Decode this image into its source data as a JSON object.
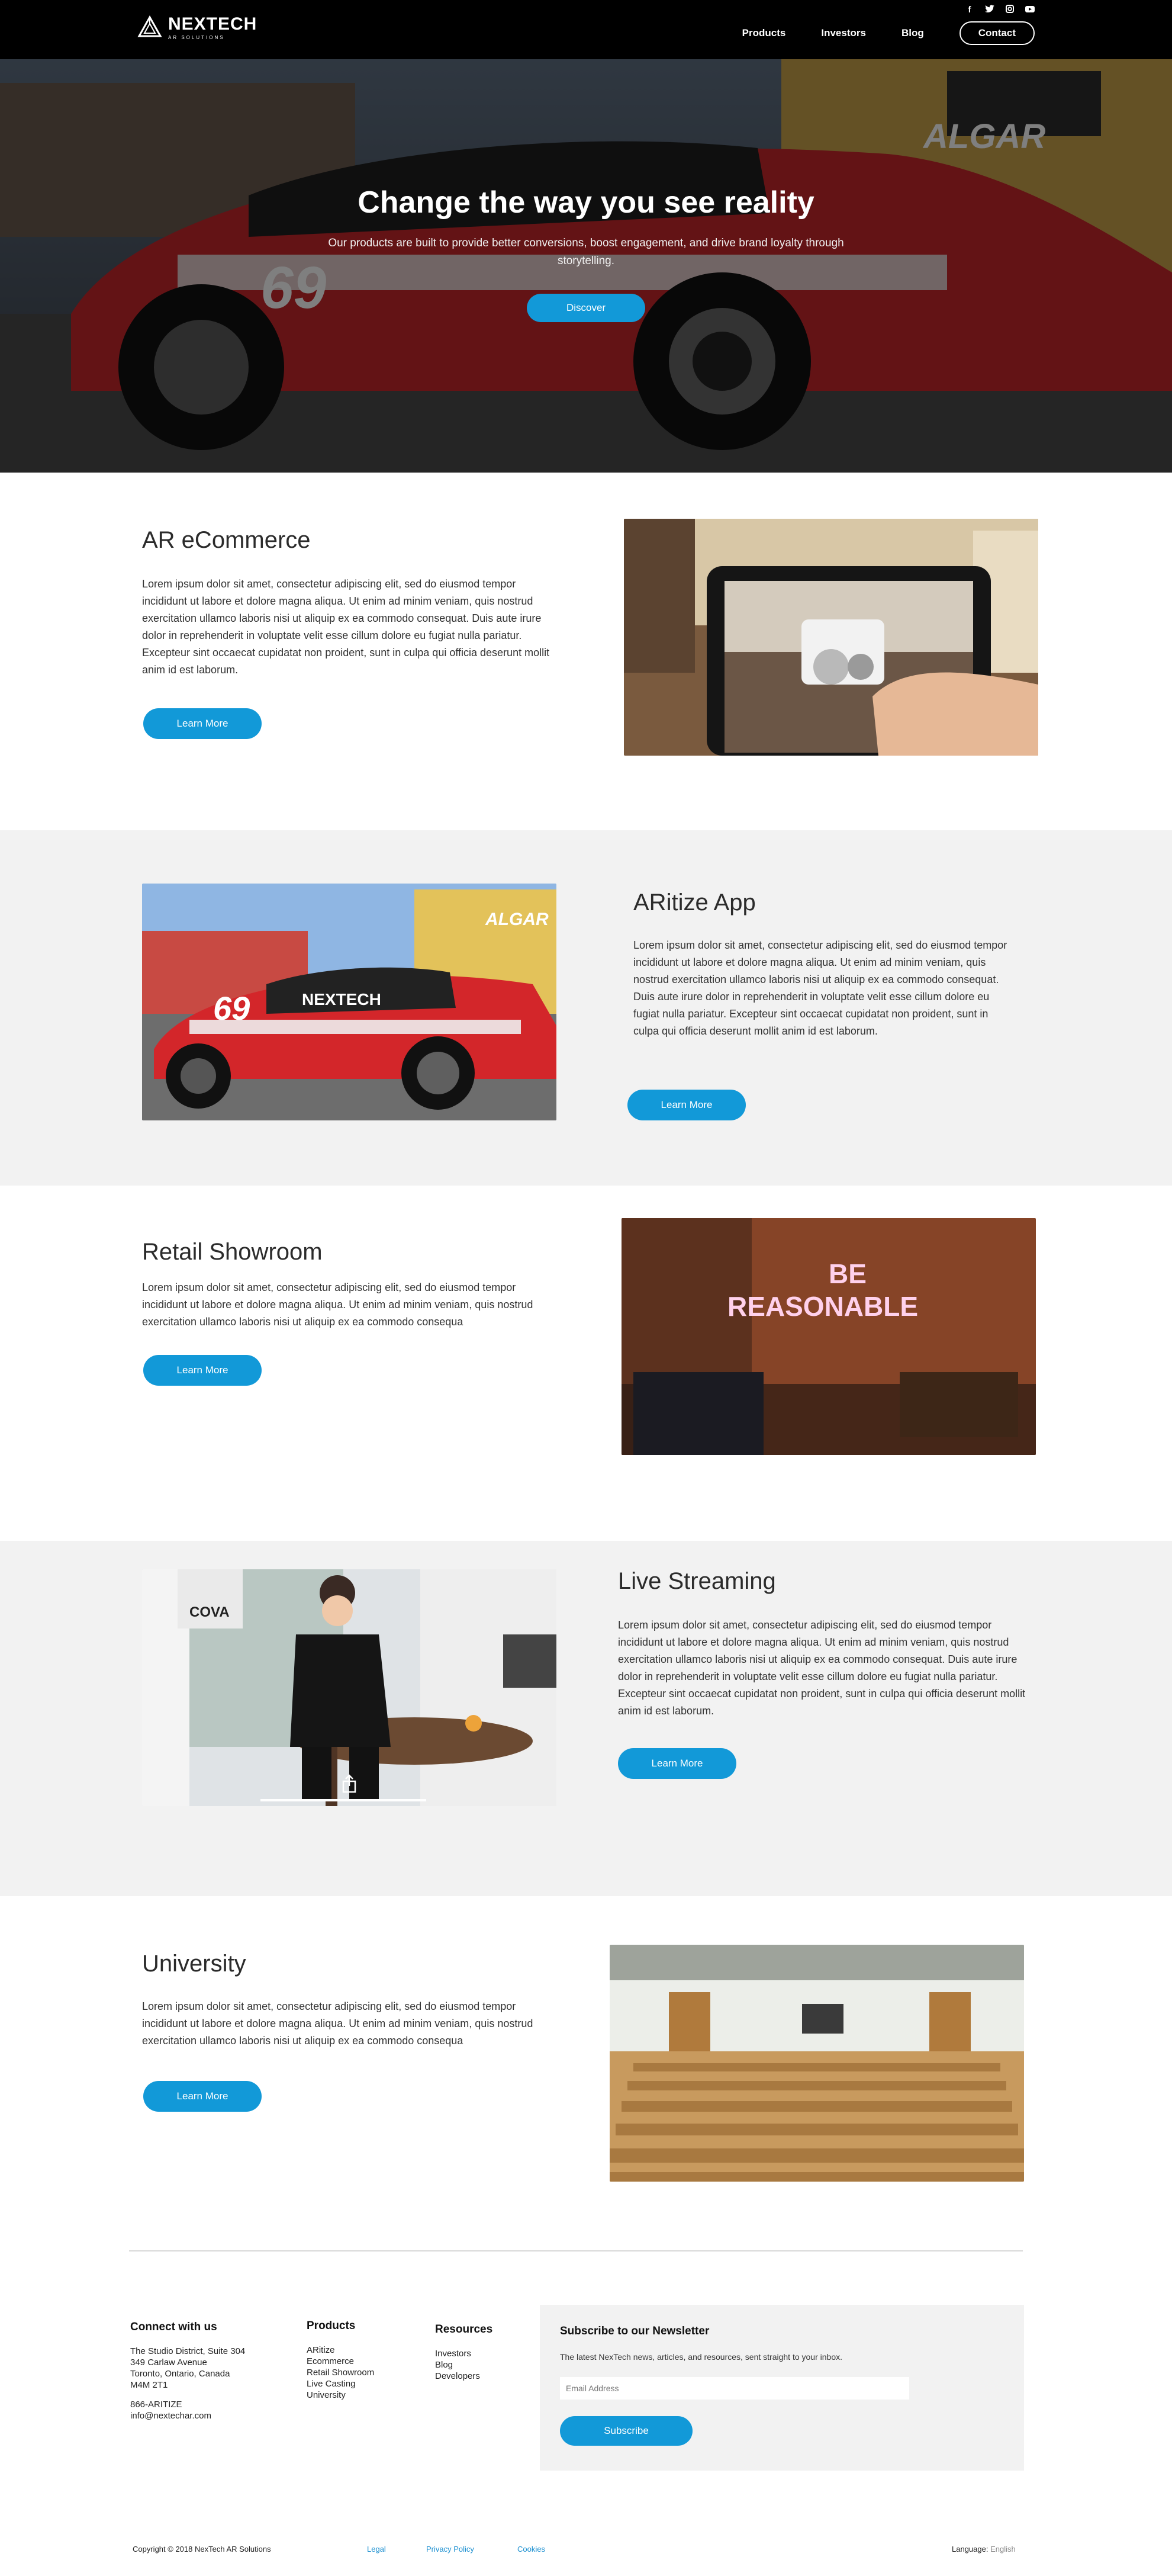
{
  "nav": {
    "brand_name": "NEXTECH",
    "brand_sub": "AR SOLUTIONS",
    "socials": [
      "f",
      "t",
      "ig",
      "yt"
    ],
    "links": [
      "Products",
      "Investors",
      "Blog"
    ],
    "contact": "Contact"
  },
  "hero": {
    "title": "Change the way you see reality",
    "subtitle": "Our products are built to provide better conversions, boost engagement, and drive brand loyalty through storytelling.",
    "button": "Discover"
  },
  "sections": [
    {
      "title": "AR eCommerce",
      "body": "Lorem ipsum dolor sit amet, consectetur adipiscing elit, sed do eiusmod tempor incididunt ut labore et dolore magna aliqua. Ut enim ad minim veniam, quis nostrud exercitation ullamco laboris nisi ut aliquip ex ea commodo consequat. Duis aute irure dolor in reprehenderit in voluptate velit esse cillum dolore eu fugiat nulla pariatur. Excepteur sint occaecat cupidatat non proident, sunt in culpa qui officia deserunt mollit anim id est laborum.",
      "button": "Learn More"
    },
    {
      "title": "ARitize  App",
      "body": "Lorem ipsum dolor sit amet, consectetur adipiscing elit, sed do eiusmod tempor incididunt ut labore et dolore magna aliqua. Ut enim ad minim veniam, quis nostrud exercitation ullamco laboris nisi ut aliquip ex ea commodo consequat. Duis aute irure dolor in reprehenderit in voluptate velit esse cillum dolore eu fugiat nulla pariatur. Excepteur sint occaecat cupidatat non proident, sunt in culpa qui officia deserunt mollit anim id est laborum.",
      "button": "Learn More"
    },
    {
      "title": "Retail Showroom",
      "body": "Lorem ipsum dolor sit amet, consectetur adipiscing elit, sed do eiusmod tempor incididunt ut labore et dolore magna aliqua. Ut enim ad minim veniam, quis nostrud exercitation ullamco laboris nisi ut aliquip ex ea commodo consequa",
      "button": "Learn More",
      "sign_line1": "BE",
      "sign_line2": "REASONABLE"
    },
    {
      "title": "Live Streaming",
      "body": "Lorem ipsum dolor sit amet, consectetur adipiscing elit, sed do eiusmod tempor incididunt ut labore et dolore magna aliqua. Ut enim ad minim veniam, quis nostrud exercitation ullamco laboris nisi ut aliquip ex ea commodo consequat. Duis aute irure dolor in reprehenderit in voluptate velit esse cillum dolore eu fugiat nulla pariatur. Excepteur sint occaecat cupidatat non proident, sunt in culpa qui officia deserunt mollit anim id est laborum.",
      "button": "Learn More",
      "logo_text": "COVA"
    },
    {
      "title": "University",
      "body": "Lorem ipsum dolor sit amet, consectetur adipiscing elit, sed do eiusmod tempor incididunt ut labore et dolore magna aliqua. Ut enim ad minim veniam, quis nostrud exercitation ullamco laboris nisi ut aliquip ex ea commodo consequa",
      "button": "Learn More"
    }
  ],
  "car_text": {
    "number": "69",
    "brand": "NEXTECH",
    "sponsor": "ALGAR"
  },
  "footer": {
    "connect": {
      "title": "Connect with us",
      "address": [
        "The Studio District, Suite 304",
        "349 Carlaw Avenue",
        "Toronto, Ontario, Canada",
        "M4M 2T1"
      ],
      "phone": "866-ARITIZE",
      "email": "info@nextechar.com"
    },
    "products": {
      "title": "Products",
      "items": [
        "ARitize",
        "Ecommerce",
        "Retail Showroom",
        "Live Casting",
        "University"
      ]
    },
    "resources": {
      "title": "Resources",
      "items": [
        "Investors",
        "Blog",
        "Developers"
      ]
    },
    "newsletter": {
      "title": "Subscribe to our Newsletter",
      "description": "The latest NexTech news, articles, and resources, sent straight to your inbox.",
      "placeholder": "Email Address",
      "button": "Subscribe"
    },
    "copyright": "Copyright © 2018 NexTech AR Solutions",
    "links": [
      "Legal",
      "Privacy Policy",
      "Cookies"
    ],
    "language_label": "Language:",
    "language_value": "English"
  },
  "colors": {
    "accent": "#1299d8",
    "nav_bg": "#000000",
    "grey_section": "#f2f2f2",
    "car_red": "#d3262a"
  }
}
